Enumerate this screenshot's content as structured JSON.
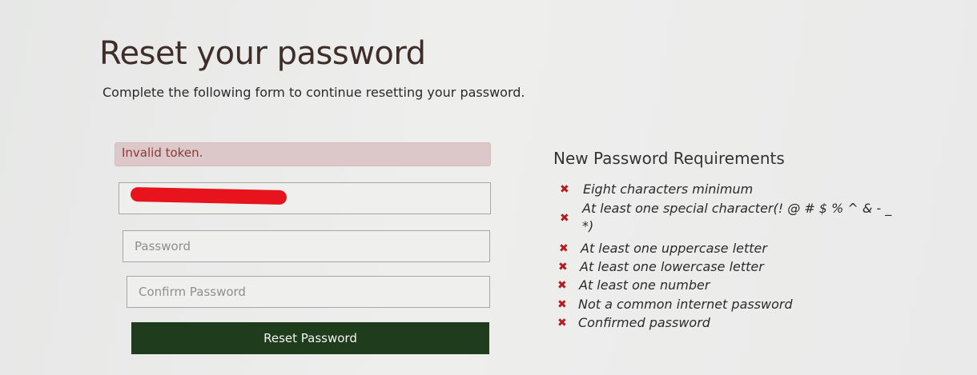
{
  "page": {
    "title": "Reset your password",
    "subtitle": "Complete the following form to continue resetting your password."
  },
  "alert": {
    "text": "Invalid token."
  },
  "form": {
    "email_value": "",
    "password_placeholder": "Password",
    "confirm_placeholder": "Confirm Password",
    "submit_label": "Reset Password"
  },
  "requirements": {
    "title": "New Password Requirements",
    "status_icon": "x-mark-icon",
    "status_color": "#b31d1d",
    "items": [
      {
        "label": "Eight characters minimum",
        "met": false
      },
      {
        "label": "At least one special character(! @ # $ % ^ & - _",
        "label_cont": "*)",
        "met": false
      },
      {
        "label": "At least one uppercase letter",
        "met": false
      },
      {
        "label": "At least one lowercase letter",
        "met": false
      },
      {
        "label": "At least one number",
        "met": false
      },
      {
        "label": "Not a common internet password",
        "met": false
      },
      {
        "label": "Confirmed password",
        "met": false
      }
    ]
  },
  "colors": {
    "button_bg": "#1f3d1c",
    "alert_bg": "#dcc8c9",
    "alert_text": "#8a3a3e"
  }
}
